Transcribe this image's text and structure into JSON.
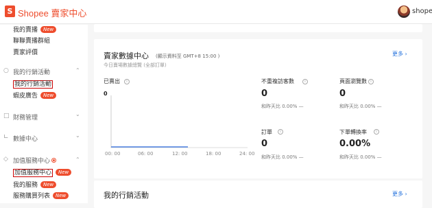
{
  "header": {
    "logo_letter": "S",
    "title": "Shopee 賣家中心",
    "username": "shopee"
  },
  "sidebar": {
    "items": [
      {
        "label": "我的賣播",
        "badge": "New"
      },
      {
        "label": "聯聯賣播群組"
      },
      {
        "label": "賣家評價"
      }
    ],
    "marketing": {
      "label": "我的行銷活動",
      "children": [
        {
          "label": "我的行銷活動"
        },
        {
          "label": "蝦皮廣告",
          "badge": "New"
        }
      ]
    },
    "finance": {
      "label": "財務管理"
    },
    "data": {
      "label": "數據中心"
    },
    "value_added": {
      "label": "加值服務中心",
      "children": [
        {
          "label": "加值服務中心",
          "badge": "New"
        },
        {
          "label": "我的服務",
          "badge": "New"
        },
        {
          "label": "服務購買列表",
          "badge": "New"
        }
      ]
    }
  },
  "data_center": {
    "title": "賣家數據中心",
    "subtitle": "(顯示資料至 GMT+8 15:00 )",
    "desc": "今日賣場數據總覽 (全部訂單)",
    "more": "更多",
    "sales_label": "已賣出",
    "sales_value": "0",
    "x_ticks": [
      "00: 00",
      "06: 00",
      "12: 00",
      "18: 00",
      "24: 00"
    ],
    "metrics": [
      {
        "label": "不重複訪客數",
        "value": "0",
        "compare": "和昨天比 0.00% —"
      },
      {
        "label": "頁面瀏覽數",
        "value": "0",
        "compare": "和昨天比 0.00% —"
      },
      {
        "label": "訂單",
        "value": "0",
        "compare": "和昨天比 0.00% —"
      },
      {
        "label": "下單轉換率",
        "value": "0.00%",
        "compare": "和昨天比 0.00% —"
      }
    ]
  },
  "marketing_card": {
    "title": "我的行銷活動",
    "more": "更多"
  }
}
